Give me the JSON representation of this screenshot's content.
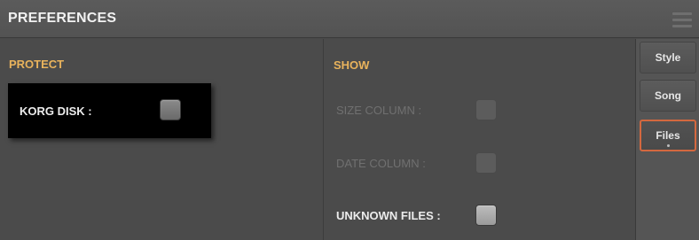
{
  "window": {
    "title": "PREFERENCES",
    "menu_icon": "hamburger-menu-icon"
  },
  "protect": {
    "title": "PROTECT",
    "korg_disk": {
      "label": "KORG DISK :",
      "checked": false,
      "enabled": true
    }
  },
  "show": {
    "title": "SHOW",
    "size_column": {
      "label": "SIZE COLUMN :",
      "checked": false,
      "enabled": false
    },
    "date_column": {
      "label": "DATE COLUMN :",
      "checked": false,
      "enabled": false
    },
    "unknown_files": {
      "label": "UNKNOWN FILES :",
      "checked": false,
      "enabled": true
    }
  },
  "tabs": [
    {
      "label": "Style",
      "active": false
    },
    {
      "label": "Song",
      "active": false
    },
    {
      "label": "Files",
      "active": true
    }
  ],
  "colors": {
    "section_title": "#e9b35c",
    "active_tab_border": "#d4683f"
  }
}
